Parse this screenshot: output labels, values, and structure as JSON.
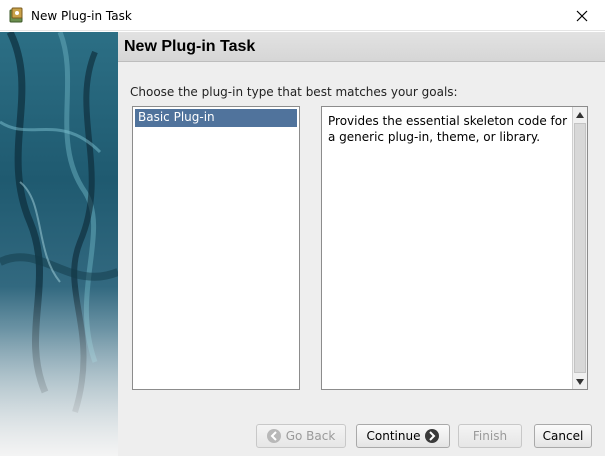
{
  "window": {
    "title": "New Plug-in Task"
  },
  "header": {
    "title": "New Plug-in Task"
  },
  "prompt": "Choose the plug-in type that best matches your goals:",
  "plugin_types": [
    {
      "label": "Basic Plug-in",
      "selected": true
    }
  ],
  "description": "Provides the essential skeleton code for a generic plug-in, theme, or library.",
  "buttons": {
    "back": {
      "label": "Go Back",
      "enabled": false
    },
    "continue": {
      "label": "Continue",
      "enabled": true
    },
    "finish": {
      "label": "Finish",
      "enabled": false
    },
    "cancel": {
      "label": "Cancel",
      "enabled": true
    }
  },
  "colors": {
    "selection": "#50739c",
    "panel_background": "#eeeeee"
  }
}
